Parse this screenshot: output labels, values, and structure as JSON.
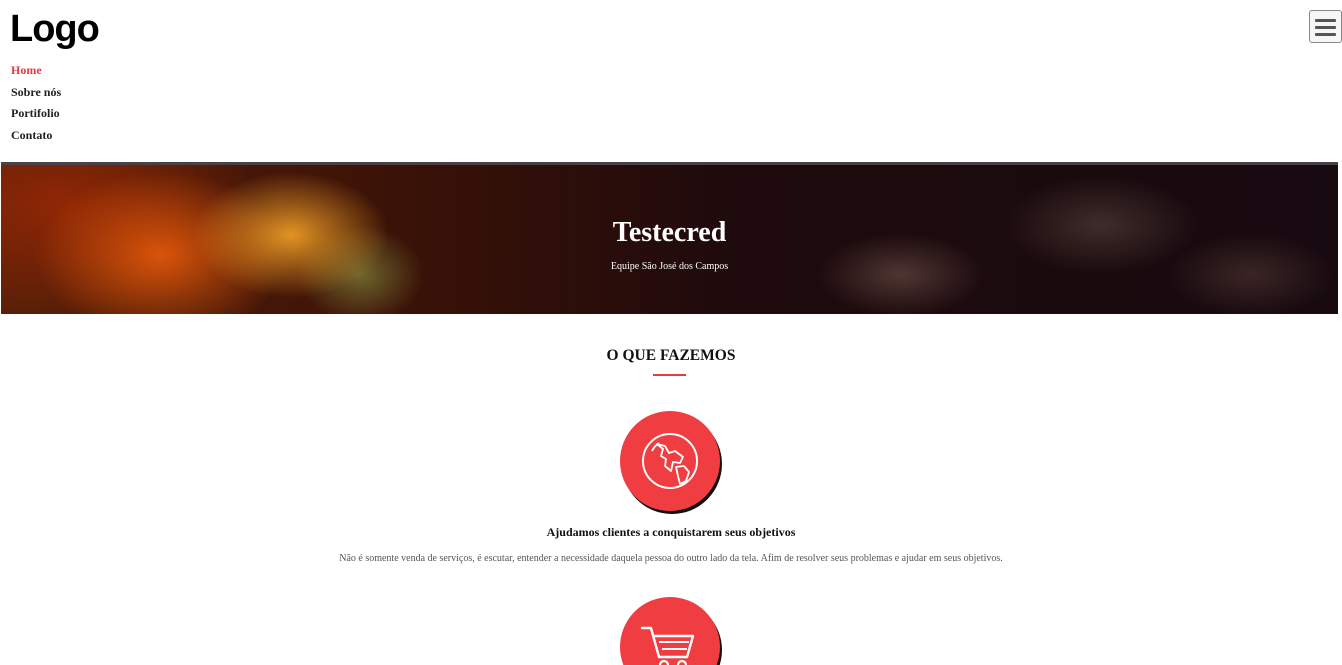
{
  "header": {
    "logo_text": "Logo",
    "nav": [
      {
        "label": "Home",
        "active": true
      },
      {
        "label": "Sobre nós",
        "active": false
      },
      {
        "label": "Portifolio",
        "active": false
      },
      {
        "label": "Contato",
        "active": false
      }
    ],
    "menu_icon": "hamburger-menu-icon"
  },
  "hero": {
    "title": "Testecred",
    "subtitle": "Equipe São José dos Campos"
  },
  "services_section": {
    "title": "O QUE FAZEMOS",
    "items": [
      {
        "icon": "globe-icon",
        "title": "Ajudamos clientes a conquistarem seus objetivos",
        "description": "Não é somente venda de serviços, é escutar, entender a necessidade daquela pessoa do outro lado da tela. Afim de resolver seus problemas e ajudar em seus objetivos."
      },
      {
        "icon": "shopping-cart-icon"
      }
    ]
  },
  "colors": {
    "accent": "#e53a3f",
    "icon_circle": "#f03d42"
  }
}
